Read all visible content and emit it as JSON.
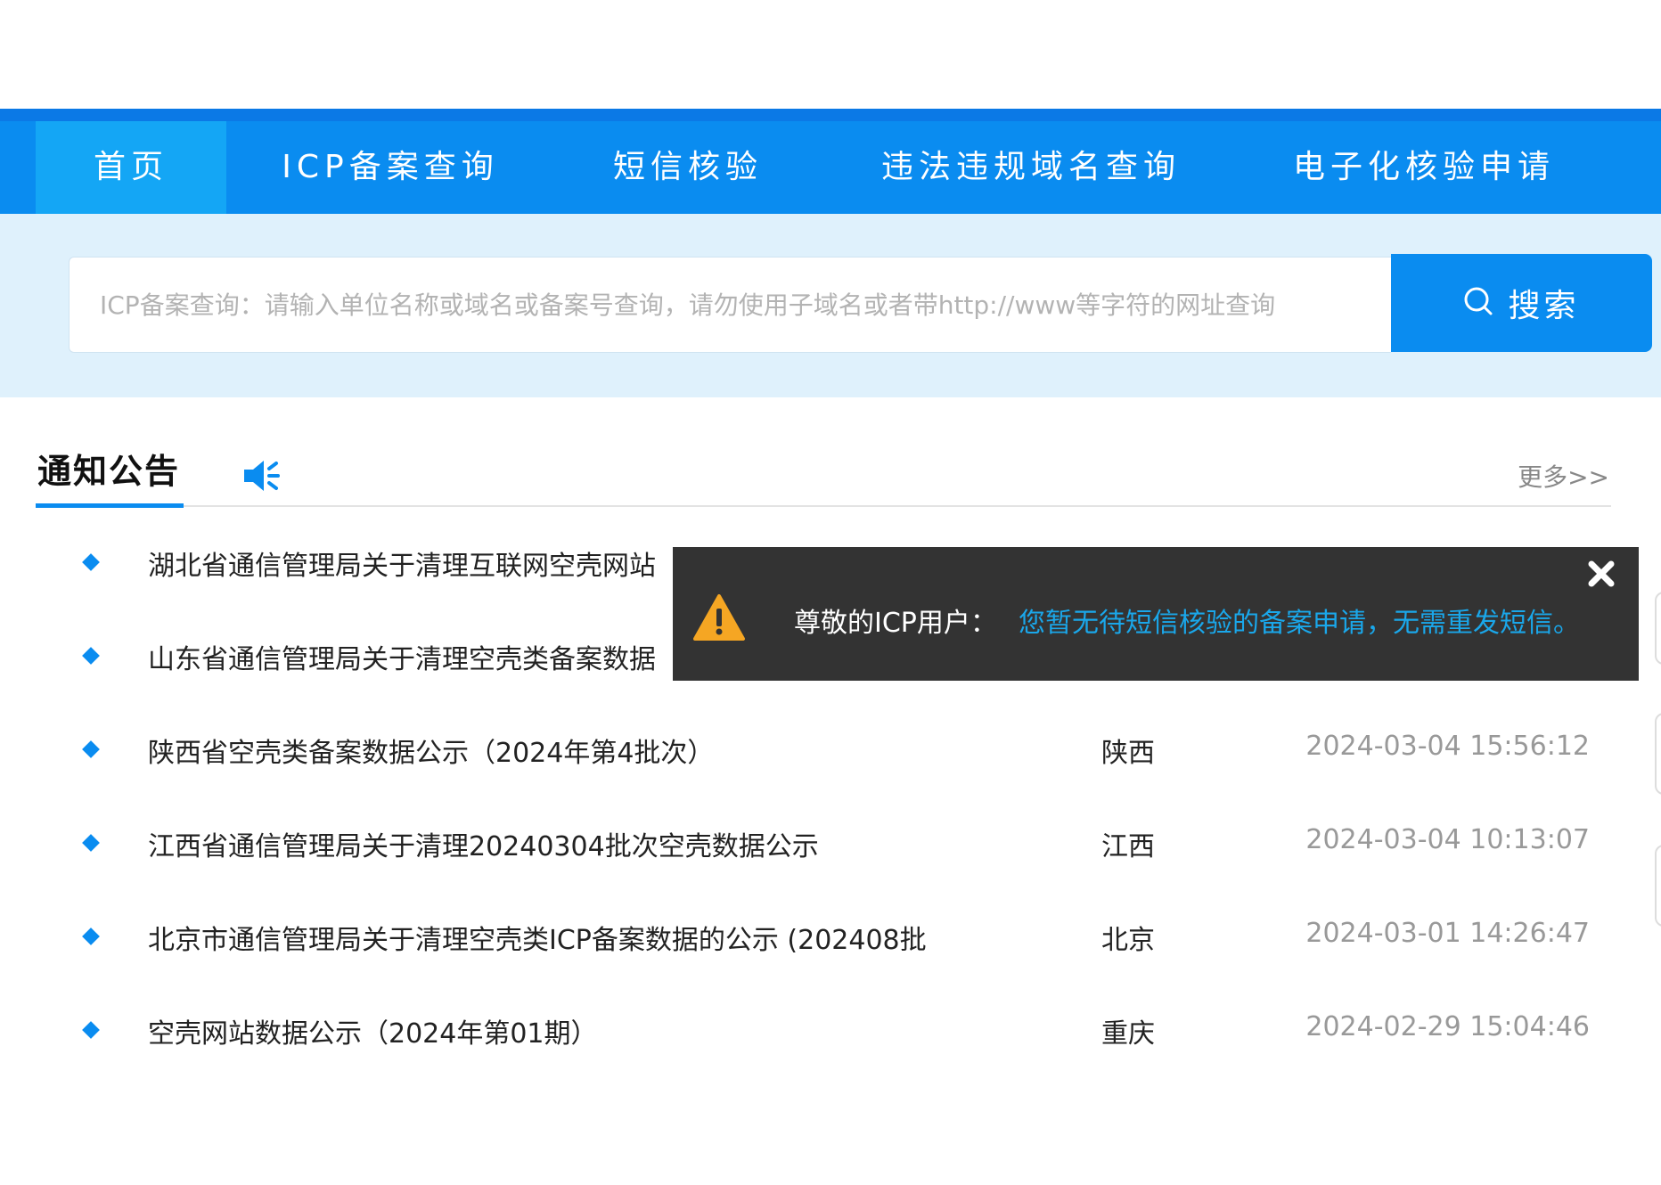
{
  "nav": {
    "items": [
      {
        "label": "首页"
      },
      {
        "label": "ICP备案查询"
      },
      {
        "label": "短信核验"
      },
      {
        "label": "违法违规域名查询"
      },
      {
        "label": "电子化核验申请"
      }
    ]
  },
  "search": {
    "placeholder": "ICP备案查询：请输入单位名称或域名或备案号查询，请勿使用子域名或者带http://www等字符的网址查询",
    "button_label": "搜索"
  },
  "notices": {
    "title": "通知公告",
    "more_label": "更多>>",
    "items": [
      {
        "title": "湖北省通信管理局关于清理互联网空壳网站",
        "region": "",
        "date": ""
      },
      {
        "title": "山东省通信管理局关于清理空壳类备案数据",
        "region": "",
        "date": ""
      },
      {
        "title": "陕西省空壳类备案数据公示（2024年第4批次）",
        "region": "陕西",
        "date": "2024-03-04 15:56:12"
      },
      {
        "title": "江西省通信管理局关于清理20240304批次空壳数据公示",
        "region": "江西",
        "date": "2024-03-04 10:13:07"
      },
      {
        "title": "北京市通信管理局关于清理空壳类ICP备案数据的公示 (202408批",
        "region": "北京",
        "date": "2024-03-01 14:26:47"
      },
      {
        "title": "空壳网站数据公示（2024年第01期）",
        "region": "重庆",
        "date": "2024-02-29 15:04:46"
      }
    ]
  },
  "toast": {
    "lead": "尊敬的ICP用户：",
    "message": "您暂无待短信核验的备案申请，无需重发短信。"
  },
  "colors": {
    "brand_blue": "#0a8cf0",
    "active_tab": "#14a6f5",
    "search_band": "#dff1fc",
    "toast_bg": "#333333",
    "toast_text_accent": "#1aa7ea",
    "warning": "#f5a623"
  },
  "icons": {
    "search": "search-icon",
    "speaker": "speaker-icon",
    "bullet": "diamond-bullet-icon",
    "warning": "warning-icon",
    "close": "close-icon"
  }
}
